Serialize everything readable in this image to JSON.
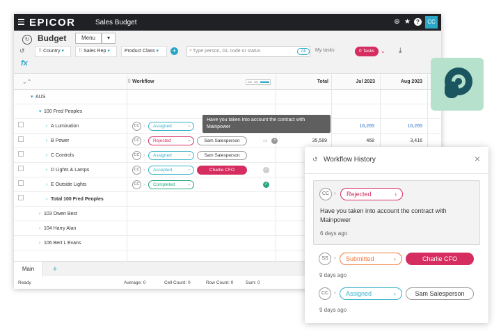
{
  "topbar": {
    "brand": "EPICOR",
    "app_title": "Sales Budget",
    "avatar": "CC",
    "icons": [
      "add-circle-icon",
      "star-icon",
      "help-icon"
    ]
  },
  "header": {
    "title": "Budget",
    "menu_label": "Menu",
    "menu_caret": "▾",
    "filters": [
      {
        "label": "Country"
      },
      {
        "label": "Sales Rep"
      },
      {
        "label": "Product Class"
      }
    ],
    "search_placeholder": "Type person, GL code or status",
    "all_label": "All",
    "my_tasks": "My tasks",
    "tasks_btn": "0 Tasks",
    "fx": "fx"
  },
  "grid": {
    "headers": {
      "workflow": "Workflow",
      "total": "Total",
      "jul": "Jul 2023",
      "aug": "Aug 2023"
    },
    "rows": [
      {
        "label": "AUS",
        "indent": 1,
        "expander": "▾"
      },
      {
        "label": "100  Fred Peoples",
        "indent": 2,
        "expander": "▾"
      },
      {
        "label": "A  Lumination",
        "indent": 3,
        "expander": "›",
        "wf_cc": "CC",
        "status": "Assigned",
        "status_color": "#38b2c9",
        "jul": "16,265",
        "aug": "16,265",
        "numcolor": "#2a72c9"
      },
      {
        "label": "B  Power",
        "indent": 3,
        "expander": "›",
        "wf_cc": "CC",
        "status": "Rejected",
        "status_color": "#d62d60",
        "person": "Sam Salesperson",
        "total": "35,589",
        "jul": "468",
        "aug": "3,416"
      },
      {
        "label": "C  Controls",
        "indent": 3,
        "expander": "›",
        "wf_cc": "CC",
        "status": "Assigned",
        "status_color": "#38b2c9",
        "person": "Sam Salesperson"
      },
      {
        "label": "D  Lights & Lamps",
        "indent": 3,
        "expander": "›",
        "wf_cc": "CC",
        "status": "Accepted",
        "status_color": "#38b2c9",
        "person": "Charlie CFO",
        "cfo": true
      },
      {
        "label": "E  Outside Lights",
        "indent": 3,
        "expander": "›",
        "wf_cc": "CC",
        "status": "Completed",
        "status_color": "#2aa682"
      },
      {
        "label": "Total 100 Fred Peoples",
        "indent": 3,
        "expander": "›",
        "bold": true
      },
      {
        "label": "103  Owen Best",
        "indent": 2,
        "expander": "›"
      },
      {
        "label": "104  Harry Alan",
        "indent": 2,
        "expander": "›"
      },
      {
        "label": "106  Bert L Evans",
        "indent": 2,
        "expander": "›"
      }
    ]
  },
  "tooltip": "Have you taken into account the contract with Mainpower",
  "tabs": {
    "main": "Main",
    "add": "+"
  },
  "status": {
    "ready": "Ready",
    "average": "Average: 0",
    "cell_count": "Cell Count: 0",
    "row_count": "Row Count: 0",
    "sum": "Sum: 0"
  },
  "panel": {
    "title": "Workflow History",
    "entries": [
      {
        "initials": "CC",
        "status": "Rejected",
        "status_color": "#d62d60",
        "comment": "Have you taken into account the contract with Mainpower",
        "time": "6 days ago"
      },
      {
        "initials": "SS",
        "status": "Submitted",
        "status_color": "#f07a3c",
        "person": "Charlie CFO",
        "cfo": true,
        "time": "9 days ago"
      },
      {
        "initials": "CC",
        "status": "Assigned",
        "status_color": "#38b2c9",
        "person": "Sam Salesperson",
        "time": "9 days ago"
      }
    ]
  },
  "colors": {
    "accent": "#2aa6c9",
    "cfo": "#d62d60",
    "dark_bar": "#202124",
    "logo_bg": "#b6e2cd",
    "logo_fg": "#1a5560"
  }
}
